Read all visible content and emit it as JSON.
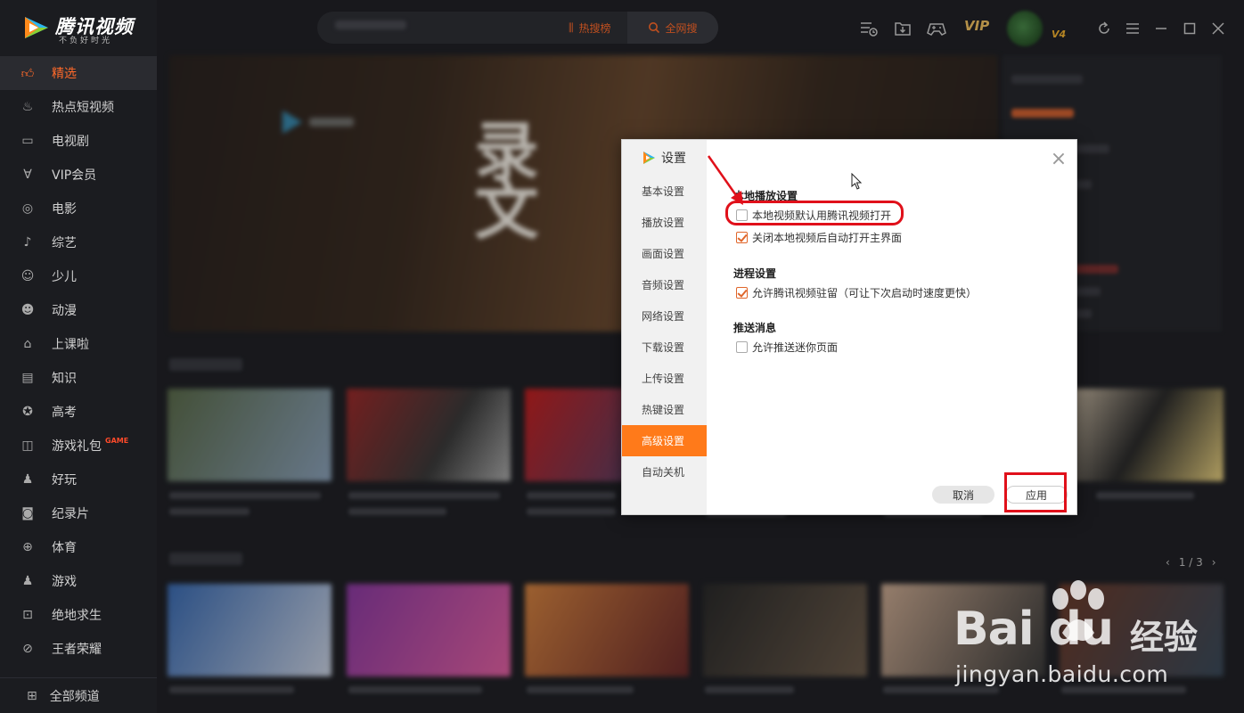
{
  "app": {
    "name": "腾讯视频",
    "slogan": "不负好时光"
  },
  "sidebar": {
    "items": [
      {
        "label": "精选",
        "icon": "thumbs-up-icon",
        "active": true
      },
      {
        "label": "热点短视频",
        "icon": "flame-icon"
      },
      {
        "label": "电视剧",
        "icon": "tv-icon"
      },
      {
        "label": "VIP会员",
        "icon": "vip-v-icon"
      },
      {
        "label": "电影",
        "icon": "film-reel-icon"
      },
      {
        "label": "综艺",
        "icon": "microphone-icon"
      },
      {
        "label": "少儿",
        "icon": "child-icon"
      },
      {
        "label": "动漫",
        "icon": "panda-icon"
      },
      {
        "label": "上课啦",
        "icon": "graduation-cap-icon"
      },
      {
        "label": "知识",
        "icon": "book-icon"
      },
      {
        "label": "高考",
        "icon": "exam-icon"
      },
      {
        "label": "游戏礼包",
        "icon": "gamepad-icon",
        "badge": "GAME"
      },
      {
        "label": "好玩",
        "icon": "joystick-icon"
      },
      {
        "label": "纪录片",
        "icon": "camera-icon"
      },
      {
        "label": "体育",
        "icon": "ball-icon"
      },
      {
        "label": "游戏",
        "icon": "joystick-icon"
      },
      {
        "label": "绝地求生",
        "icon": "pubg-icon"
      },
      {
        "label": "王者荣耀",
        "icon": "sword-icon"
      }
    ],
    "all_channels": "全部频道"
  },
  "topbar": {
    "hot_label": "热搜榜",
    "search_all_label": "全网搜",
    "vip_label": "VIP",
    "vip_badge": "V4"
  },
  "pager": {
    "text": "1 / 3"
  },
  "dialog": {
    "title": "设置",
    "menu": [
      {
        "label": "基本设置"
      },
      {
        "label": "播放设置"
      },
      {
        "label": "画面设置"
      },
      {
        "label": "音频设置"
      },
      {
        "label": "网络设置"
      },
      {
        "label": "下载设置"
      },
      {
        "label": "上传设置"
      },
      {
        "label": "热键设置"
      },
      {
        "label": "高级设置",
        "active": true
      },
      {
        "label": "自动关机"
      }
    ],
    "groups": [
      {
        "title": "本地播放设置",
        "options": [
          {
            "label": "本地视频默认用腾讯视频打开",
            "checked": false
          },
          {
            "label": "关闭本地视频后自动打开主界面",
            "checked": true
          }
        ]
      },
      {
        "title": "进程设置",
        "options": [
          {
            "label": "允许腾讯视频驻留（可让下次启动时速度更快）",
            "checked": true
          }
        ]
      },
      {
        "title": "推送消息",
        "options": [
          {
            "label": "允许推送迷你页面",
            "checked": false
          }
        ]
      }
    ],
    "cancel_label": "取消",
    "apply_label": "应用"
  },
  "watermark": {
    "brand": "Bai du",
    "brand_cn": "经验",
    "url": "jingyan.baidu.com"
  },
  "colors": {
    "accent": "#ff7a1a",
    "highlight": "#e0101a"
  }
}
